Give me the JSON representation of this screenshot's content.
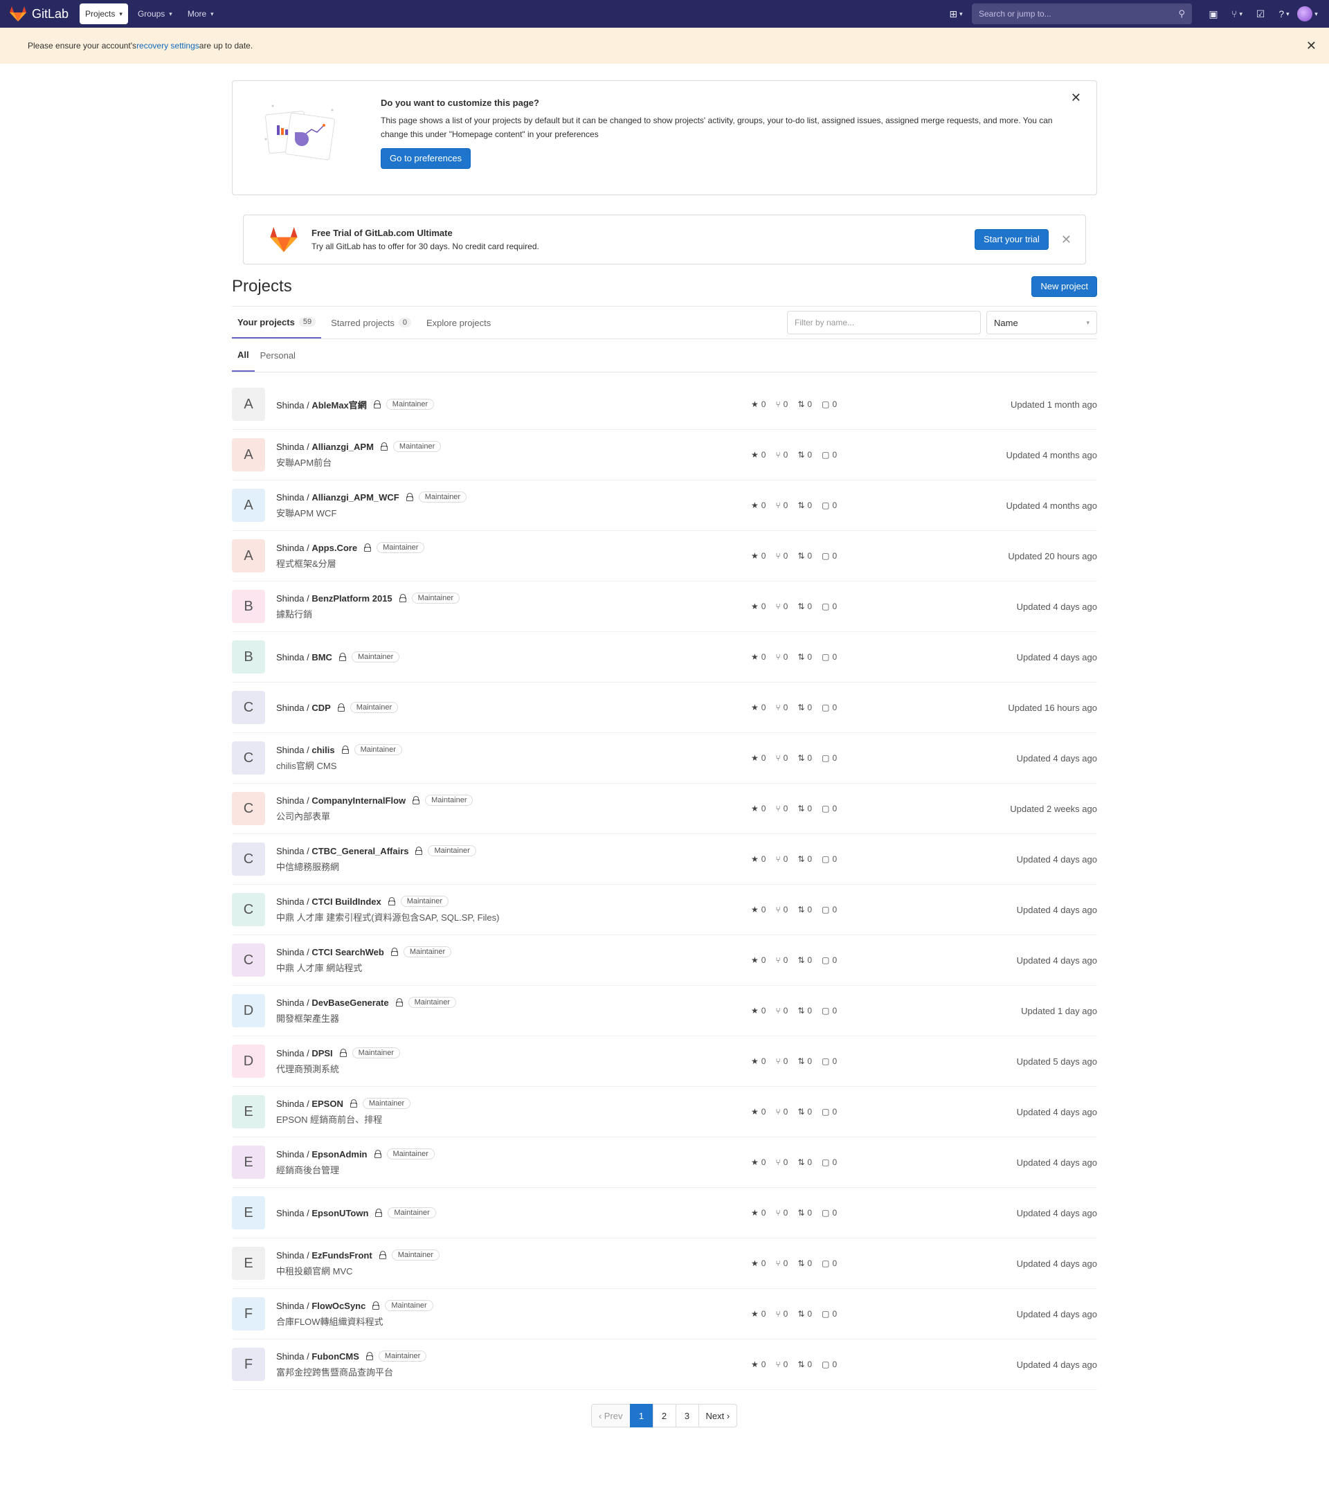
{
  "navbar": {
    "logo_text": "GitLab",
    "projects_label": "Projects",
    "groups_label": "Groups",
    "more_label": "More",
    "search_placeholder": "Search or jump to..."
  },
  "alert": {
    "prefix": "Please ensure your account's ",
    "link": "recovery settings",
    "suffix": " are up to date."
  },
  "customize": {
    "title": "Do you want to customize this page?",
    "text": "This page shows a list of your projects by default but it can be changed to show projects' activity, groups, your to-do list, assigned issues, assigned merge requests, and more. You can change this under \"Homepage content\" in your preferences",
    "button": "Go to preferences"
  },
  "trial": {
    "title": "Free Trial of GitLab.com Ultimate",
    "text": "Try all GitLab has to offer for 30 days. No credit card required.",
    "button": "Start your trial"
  },
  "page": {
    "title": "Projects",
    "new_project": "New project"
  },
  "tabs": {
    "your_projects": "Your projects",
    "your_count": "59",
    "starred": "Starred projects",
    "starred_count": "0",
    "explore": "Explore projects",
    "filter_placeholder": "Filter by name...",
    "sort": "Name",
    "sub_all": "All",
    "sub_personal": "Personal"
  },
  "projects": [
    {
      "letter": "A",
      "ns": "Shinda / ",
      "name": "AbleMax官網",
      "role": "Maintainer",
      "desc": "",
      "stars": "0",
      "forks": "0",
      "mrs": "0",
      "issues": "0",
      "updated": "Updated 1 month ago",
      "bg": "#f0f0f0"
    },
    {
      "letter": "A",
      "ns": "Shinda / ",
      "name": "Allianzgi_APM",
      "role": "Maintainer",
      "desc": "安聯APM前台",
      "stars": "0",
      "forks": "0",
      "mrs": "0",
      "issues": "0",
      "updated": "Updated 4 months ago",
      "bg": "#fbe5e1"
    },
    {
      "letter": "A",
      "ns": "Shinda / ",
      "name": "Allianzgi_APM_WCF",
      "role": "Maintainer",
      "desc": "安聯APM WCF",
      "stars": "0",
      "forks": "0",
      "mrs": "0",
      "issues": "0",
      "updated": "Updated 4 months ago",
      "bg": "#e1f0fa"
    },
    {
      "letter": "A",
      "ns": "Shinda / ",
      "name": "Apps.Core",
      "role": "Maintainer",
      "desc": "程式框架&分層",
      "stars": "0",
      "forks": "0",
      "mrs": "0",
      "issues": "0",
      "updated": "Updated 20 hours ago",
      "bg": "#fbe5e1"
    },
    {
      "letter": "B",
      "ns": "Shinda / ",
      "name": "BenzPlatform 2015",
      "role": "Maintainer",
      "desc": "據點行銷",
      "stars": "0",
      "forks": "0",
      "mrs": "0",
      "issues": "0",
      "updated": "Updated 4 days ago",
      "bg": "#fce5ee"
    },
    {
      "letter": "B",
      "ns": "Shinda / ",
      "name": "BMC",
      "role": "Maintainer",
      "desc": "",
      "stars": "0",
      "forks": "0",
      "mrs": "0",
      "issues": "0",
      "updated": "Updated 4 days ago",
      "bg": "#e0f2ee"
    },
    {
      "letter": "C",
      "ns": "Shinda / ",
      "name": "CDP",
      "role": "Maintainer",
      "desc": "",
      "stars": "0",
      "forks": "0",
      "mrs": "0",
      "issues": "0",
      "updated": "Updated 16 hours ago",
      "bg": "#e8e8f4"
    },
    {
      "letter": "C",
      "ns": "Shinda / ",
      "name": "chilis",
      "role": "Maintainer",
      "desc": "chilis官網 CMS",
      "stars": "0",
      "forks": "0",
      "mrs": "0",
      "issues": "0",
      "updated": "Updated 4 days ago",
      "bg": "#e8e8f4"
    },
    {
      "letter": "C",
      "ns": "Shinda / ",
      "name": "CompanyInternalFlow",
      "role": "Maintainer",
      "desc": "公司內部表單",
      "stars": "0",
      "forks": "0",
      "mrs": "0",
      "issues": "0",
      "updated": "Updated 2 weeks ago",
      "bg": "#fbe5e1"
    },
    {
      "letter": "C",
      "ns": "Shinda / ",
      "name": "CTBC_General_Affairs",
      "role": "Maintainer",
      "desc": "中信總務服務網",
      "stars": "0",
      "forks": "0",
      "mrs": "0",
      "issues": "0",
      "updated": "Updated 4 days ago",
      "bg": "#e8e8f4"
    },
    {
      "letter": "C",
      "ns": "Shinda / ",
      "name": "CTCI BuildIndex",
      "role": "Maintainer",
      "desc": "中鼎 人才庫 建索引程式(資料源包含SAP, SQL.SP, Files)",
      "stars": "0",
      "forks": "0",
      "mrs": "0",
      "issues": "0",
      "updated": "Updated 4 days ago",
      "bg": "#e0f2ee"
    },
    {
      "letter": "C",
      "ns": "Shinda / ",
      "name": "CTCI SearchWeb",
      "role": "Maintainer",
      "desc": "中鼎 人才庫 網站程式",
      "stars": "0",
      "forks": "0",
      "mrs": "0",
      "issues": "0",
      "updated": "Updated 4 days ago",
      "bg": "#f1e3f5"
    },
    {
      "letter": "D",
      "ns": "Shinda / ",
      "name": "DevBaseGenerate",
      "role": "Maintainer",
      "desc": "開發框架產生器",
      "stars": "0",
      "forks": "0",
      "mrs": "0",
      "issues": "0",
      "updated": "Updated 1 day ago",
      "bg": "#e1f0fa"
    },
    {
      "letter": "D",
      "ns": "Shinda / ",
      "name": "DPSI",
      "role": "Maintainer",
      "desc": "代理商預測系統",
      "stars": "0",
      "forks": "0",
      "mrs": "0",
      "issues": "0",
      "updated": "Updated 5 days ago",
      "bg": "#fce5ee"
    },
    {
      "letter": "E",
      "ns": "Shinda / ",
      "name": "EPSON",
      "role": "Maintainer",
      "desc": "EPSON 經銷商前台、排程",
      "stars": "0",
      "forks": "0",
      "mrs": "0",
      "issues": "0",
      "updated": "Updated 4 days ago",
      "bg": "#e0f2ee"
    },
    {
      "letter": "E",
      "ns": "Shinda / ",
      "name": "EpsonAdmin",
      "role": "Maintainer",
      "desc": "經銷商後台管理",
      "stars": "0",
      "forks": "0",
      "mrs": "0",
      "issues": "0",
      "updated": "Updated 4 days ago",
      "bg": "#f1e3f5"
    },
    {
      "letter": "E",
      "ns": "Shinda / ",
      "name": "EpsonUTown",
      "role": "Maintainer",
      "desc": "",
      "stars": "0",
      "forks": "0",
      "mrs": "0",
      "issues": "0",
      "updated": "Updated 4 days ago",
      "bg": "#e1f0fa"
    },
    {
      "letter": "E",
      "ns": "Shinda / ",
      "name": "EzFundsFront",
      "role": "Maintainer",
      "desc": "中租投顧官網 MVC",
      "stars": "0",
      "forks": "0",
      "mrs": "0",
      "issues": "0",
      "updated": "Updated 4 days ago",
      "bg": "#f0f0f0"
    },
    {
      "letter": "F",
      "ns": "Shinda / ",
      "name": "FlowOcSync",
      "role": "Maintainer",
      "desc": "合庫FLOW轉組織資料程式",
      "stars": "0",
      "forks": "0",
      "mrs": "0",
      "issues": "0",
      "updated": "Updated 4 days ago",
      "bg": "#e1f0fa"
    },
    {
      "letter": "F",
      "ns": "Shinda / ",
      "name": "FubonCMS",
      "role": "Maintainer",
      "desc": "富邦金控跨售暨商品查詢平台",
      "stars": "0",
      "forks": "0",
      "mrs": "0",
      "issues": "0",
      "updated": "Updated 4 days ago",
      "bg": "#e8e8f4"
    }
  ],
  "pagination": {
    "prev": "‹ Prev",
    "pages": [
      "1",
      "2",
      "3"
    ],
    "next": "Next ›"
  },
  "colors": {
    "navbar": "#292961",
    "primary": "#1f75cb",
    "alert_bg": "#fdf1dd"
  }
}
